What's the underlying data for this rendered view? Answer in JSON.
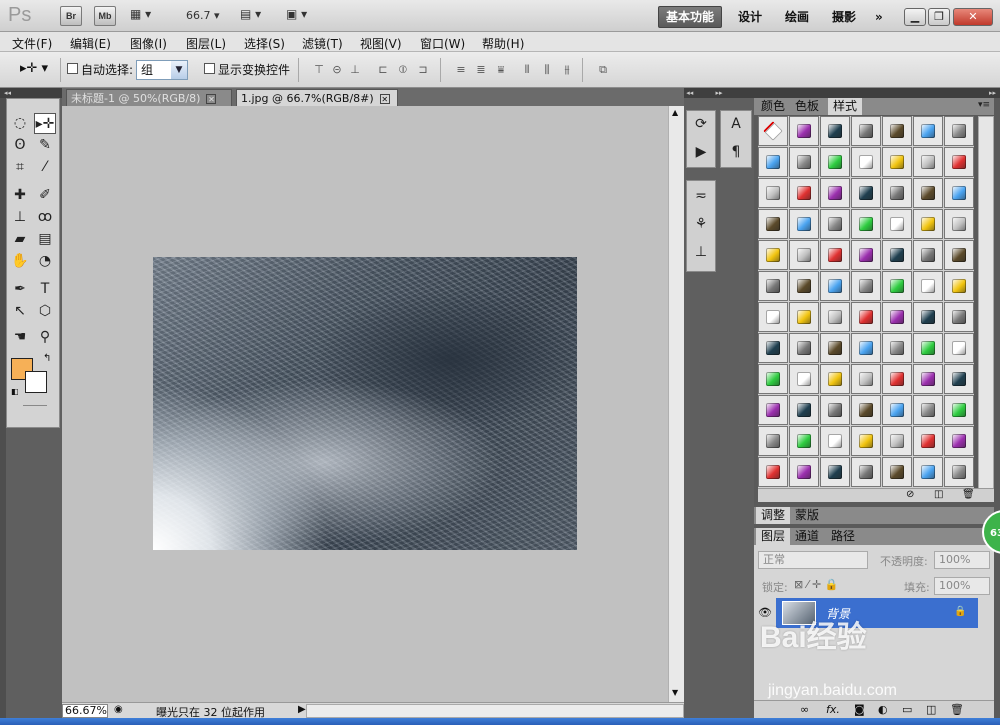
{
  "app": {
    "logo": "Ps",
    "bridge": "Br",
    "minibridge": "Mb",
    "zoom": "66.7"
  },
  "workspaces": [
    "基本功能",
    "设计",
    "绘画",
    "摄影",
    "»"
  ],
  "menu": [
    "文件(F)",
    "编辑(E)",
    "图像(I)",
    "图层(L)",
    "选择(S)",
    "滤镜(T)",
    "视图(V)",
    "窗口(W)",
    "帮助(H)"
  ],
  "options": {
    "auto_select": "自动选择:",
    "auto_select_value": "组",
    "show_transform": "显示变换控件"
  },
  "tabs": [
    {
      "label": "未标题-1 @ 50%(RGB/8)",
      "active": false
    },
    {
      "label": "1.jpg @ 66.7%(RGB/8#)",
      "active": true
    }
  ],
  "status": {
    "zoom": "66.67%",
    "message": "曝光只在 32 位起作用"
  },
  "panels": {
    "color_tabs": [
      "颜色",
      "色板",
      "样式"
    ],
    "adjust_tabs": [
      "调整",
      "蒙版"
    ],
    "layer_tabs": [
      "图层",
      "通道",
      "路径"
    ],
    "blend_mode": "正常",
    "opacity_label": "不透明度:",
    "opacity_value": "100%",
    "lock_label": "锁定:",
    "fill_label": "填充:",
    "fill_value": "100%",
    "layer_name": "背景"
  },
  "badge": "63",
  "watermark": {
    "brand": "Bai经验",
    "url": "jingyan.baidu.com"
  },
  "colors": {
    "foreground": "#f6b057",
    "background": "#ffffff",
    "accent": "#3b6fcf"
  }
}
